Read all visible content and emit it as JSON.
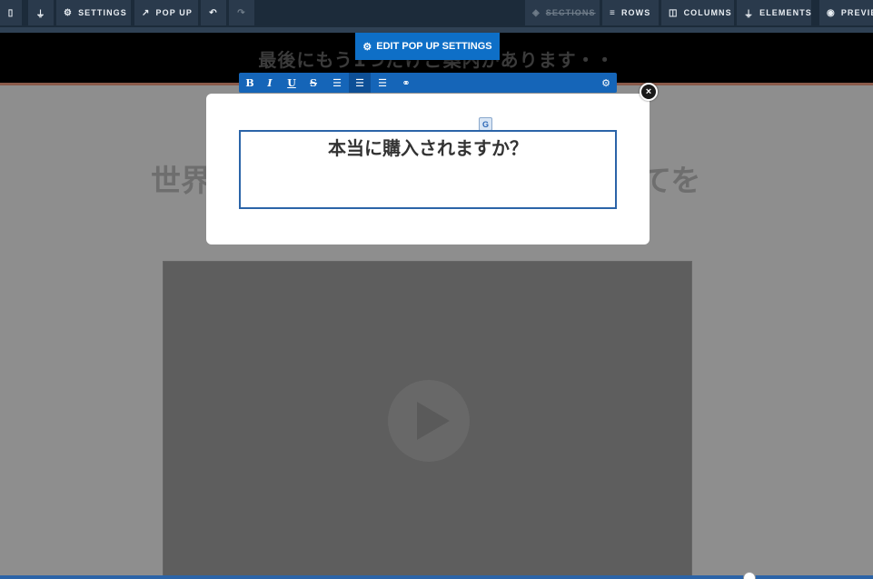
{
  "toolbar": {
    "settings_label": "SETTINGS",
    "popup_label": "POP UP",
    "sections_label": "SECTIONS",
    "rows_label": "ROWS",
    "columns_label": "COLUMNS",
    "elements_label": "ELEMENTS",
    "preview_label": "PREVIEW"
  },
  "edit_popup": {
    "label": "EDIT POP UP SETTINGS"
  },
  "page": {
    "header_text": "最後にもう1つだけご案内があります・・",
    "headline_left": "世界",
    "headline_right": "てを"
  },
  "format_bar": {
    "bold": "B",
    "italic": "I",
    "underline": "U",
    "strike": "S"
  },
  "popup": {
    "text": "本当に購入されますか？",
    "close": "×"
  },
  "icons": {
    "mobile": "mobile-icon",
    "plug": "plug-icon",
    "gears": "gears-icon",
    "external": "external-link-icon",
    "undo": "undo-icon",
    "redo": "redo-icon",
    "eye": "eye-icon",
    "translate": "translate-icon"
  },
  "colors": {
    "toolbar_bg": "#1c2b3a",
    "accent_blue": "#0e6fc7",
    "modal_border": "#2b64a8"
  }
}
